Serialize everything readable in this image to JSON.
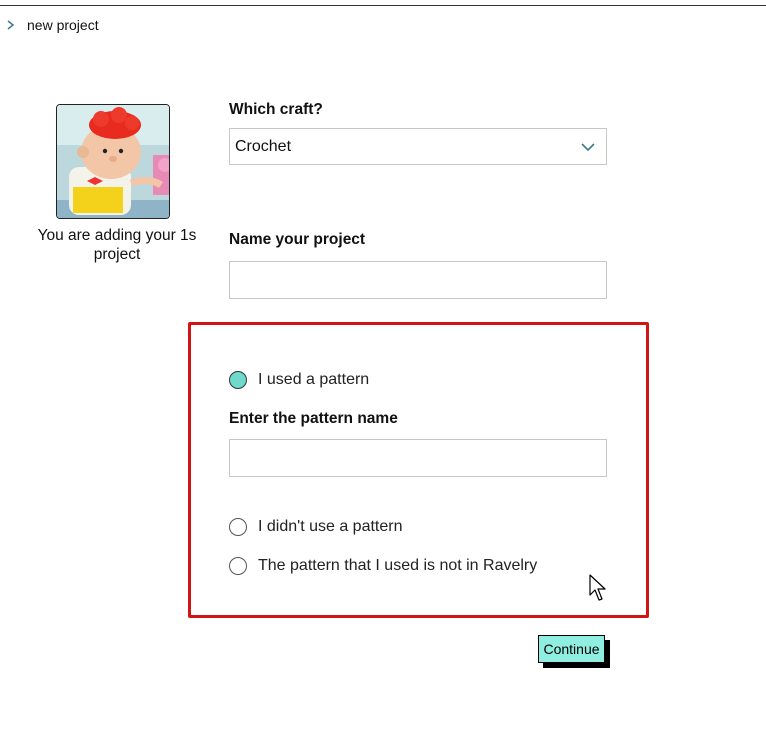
{
  "breadcrumb": {
    "current": "new project"
  },
  "avatar": {
    "caption": "You are adding your 1s project"
  },
  "craft": {
    "label": "Which craft?",
    "selected": "Crochet"
  },
  "project_name": {
    "label": "Name your project",
    "value": "",
    "placeholder": ""
  },
  "pattern": {
    "options": [
      {
        "label": "I used a pattern",
        "checked": true
      },
      {
        "label": "I didn't use a pattern",
        "checked": false
      },
      {
        "label": "The pattern that I used is not in Ravelry",
        "checked": false
      }
    ],
    "name_label": "Enter the pattern name",
    "name_value": "",
    "name_placeholder": ""
  },
  "actions": {
    "continue_label": "Continue"
  },
  "colors": {
    "accent": "#90eee0",
    "radio_checked": "#6fd9cc",
    "highlight_border": "#d11414"
  }
}
